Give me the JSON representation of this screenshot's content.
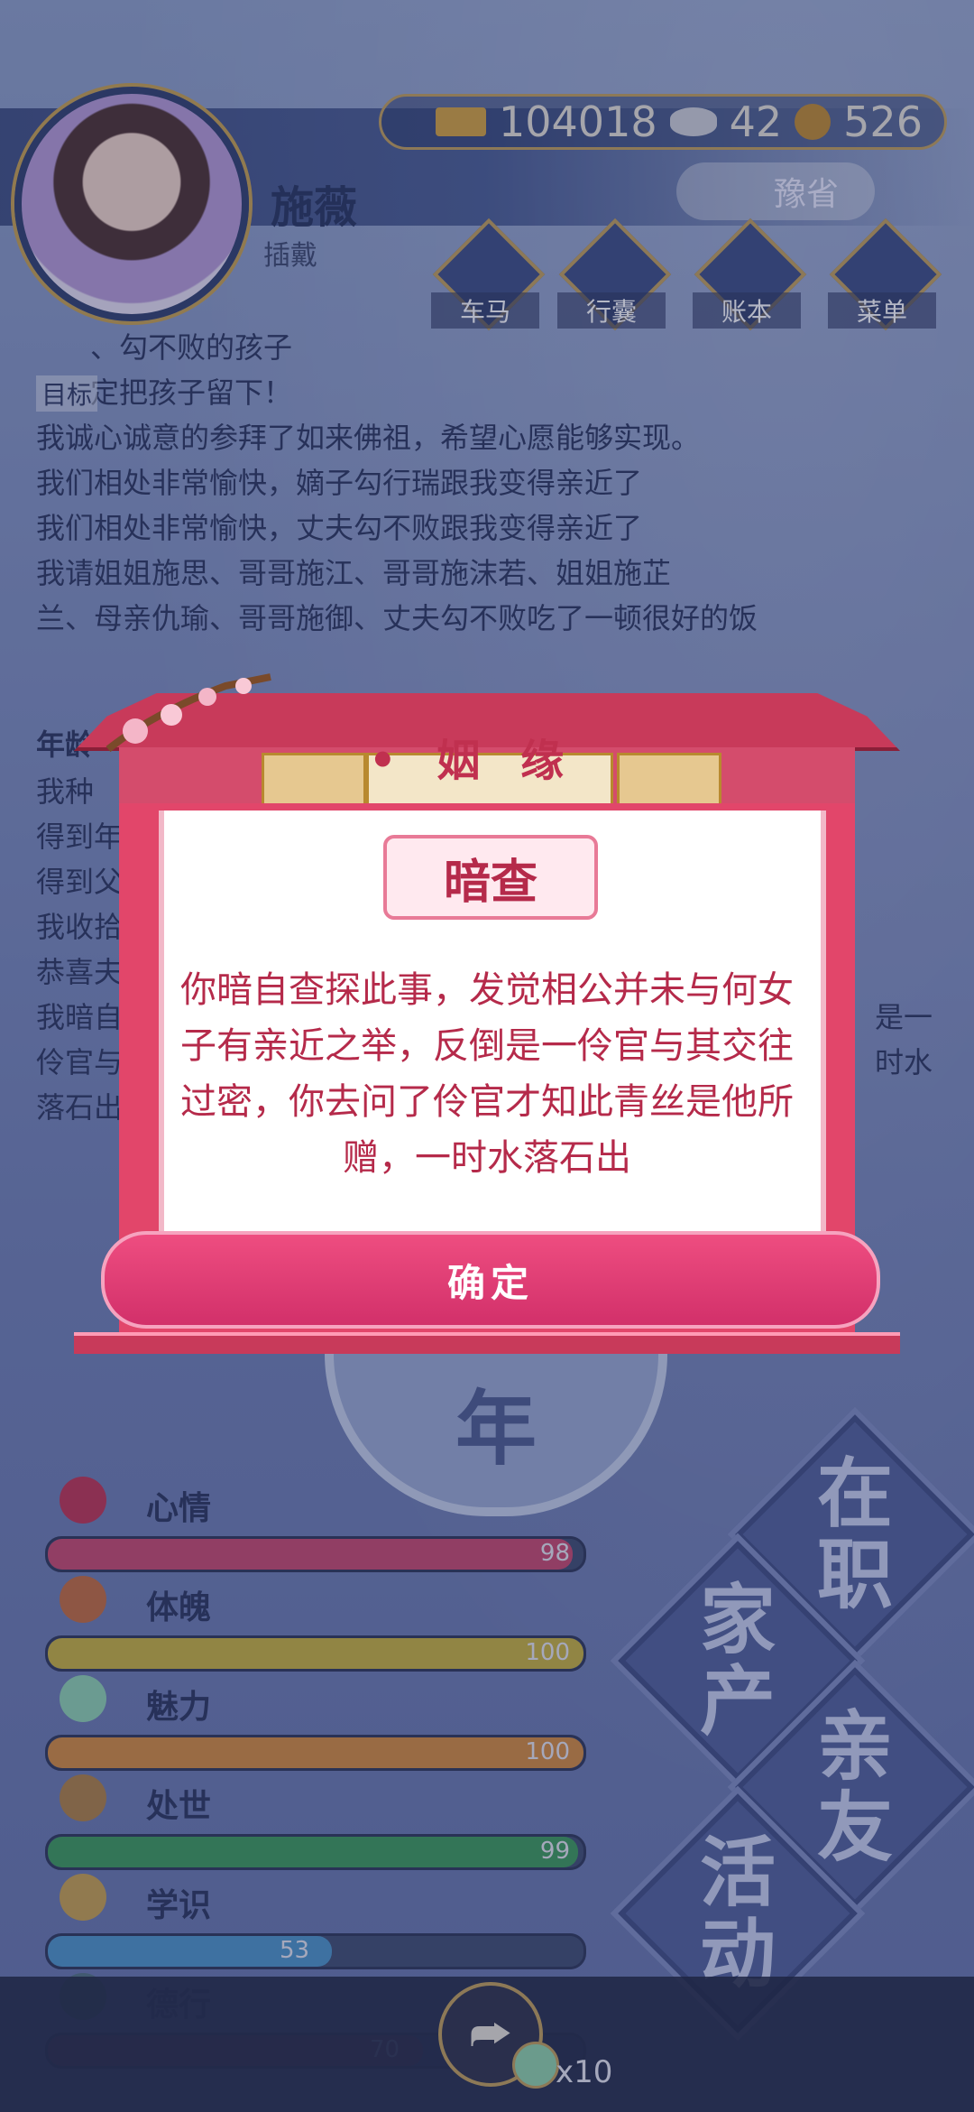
{
  "header": {
    "name": "施薇",
    "subname": "插戴",
    "currency": {
      "gold": "104018",
      "silver": "42",
      "coin": "526"
    },
    "province": "豫省",
    "nav": [
      {
        "label": "车马",
        "glyph": "🏯"
      },
      {
        "label": "行囊",
        "glyph": "🎁"
      },
      {
        "label": "账本",
        "glyph": "📘"
      },
      {
        "label": "菜单",
        "glyph": "•••"
      }
    ]
  },
  "log": {
    "target_tag": "目标",
    "lines": [
      "、勾不败的孩子",
      "定把孩子留下！",
      "我诚心诚意的参拜了如来佛祖，希望心愿能够实现。",
      "我们相处非常愉快，嫡子勾行瑞跟我变得亲近了",
      "我们相处非常愉快，丈夫勾不败跟我变得亲近了",
      "我请姐姐施思、哥哥施江、哥哥施沫若、姐姐施芷",
      "兰、母亲仇瑜、哥哥施御、丈夫勾不败吃了一顿很好的饭"
    ],
    "year_title": "年龄",
    "partial_lines": [
      "我种",
      "得到年",
      "得到父",
      "我收拾",
      "恭喜夫",
      "我暗自",
      "伶官与",
      "落石出"
    ],
    "partial_right": [
      "是一",
      "时水"
    ]
  },
  "emblem": "年",
  "stats": [
    {
      "name": "心情",
      "value": "98",
      "pct": 98,
      "color": "#c9456a"
    },
    {
      "name": "体魄",
      "value": "100",
      "pct": 100,
      "color": "#c9b23a"
    },
    {
      "name": "魅力",
      "value": "100",
      "pct": 100,
      "color": "#d68a3a"
    },
    {
      "name": "处世",
      "value": "99",
      "pct": 99,
      "color": "#3a9a56"
    },
    {
      "name": "学识",
      "value": "53",
      "pct": 53,
      "color": "#4a94c8"
    },
    {
      "name": "德行",
      "value": "70",
      "pct": 70,
      "color": "#7a2a4a"
    }
  ],
  "side_buttons": [
    {
      "label": [
        "在",
        "职"
      ]
    },
    {
      "label": [
        "家",
        "产"
      ]
    },
    {
      "label": [
        "亲",
        "友"
      ]
    },
    {
      "label": [
        "活",
        "动"
      ]
    }
  ],
  "bottom": {
    "multiplier": "x10"
  },
  "modal": {
    "title": "• 姻 缘 •",
    "subtitle": "暗查",
    "text": "你暗自查探此事，发觉相公并未与何女子有亲近之举，反倒是一伶官与其交往过密，你去问了伶官才知此青丝是他所赠，一时水落石出",
    "confirm": "确定"
  }
}
